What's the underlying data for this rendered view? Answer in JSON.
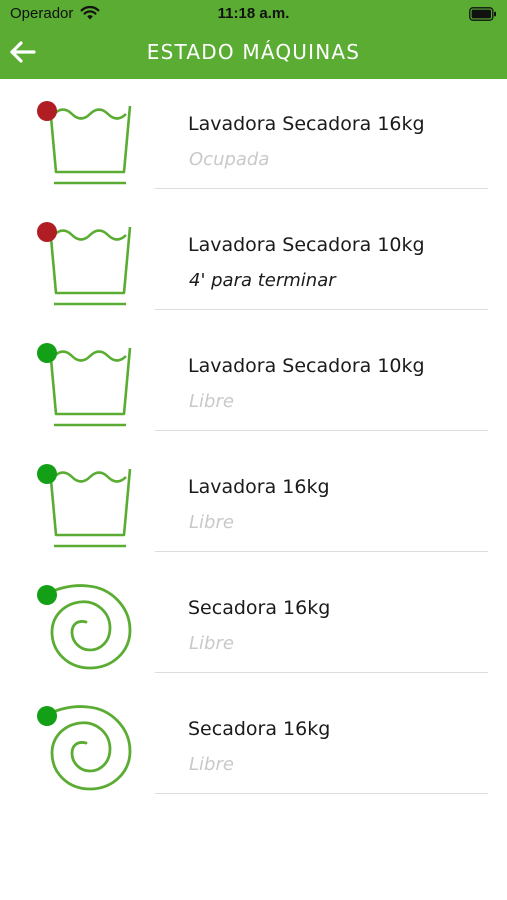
{
  "status_bar": {
    "carrier": "Operador",
    "time": "11:18 a.m."
  },
  "header": {
    "title": "ESTADO MÁQUINAS",
    "back_icon": "arrow-left-icon"
  },
  "colors": {
    "brand_green": "#5aac33",
    "busy_red": "#b01e24",
    "free_green": "#14a016"
  },
  "machines": [
    {
      "name": "Lavadora Secadora 16kg",
      "status": "Ocupada",
      "type": "washer",
      "state": "busy",
      "icon": "washer-icon"
    },
    {
      "name": "Lavadora Secadora 10kg",
      "status": "4' para terminar",
      "type": "washer",
      "state": "busy",
      "icon": "washer-icon"
    },
    {
      "name": "Lavadora Secadora 10kg",
      "status": "Libre",
      "type": "washer",
      "state": "free",
      "icon": "washer-icon"
    },
    {
      "name": "Lavadora 16kg",
      "status": "Libre",
      "type": "washer",
      "state": "free",
      "icon": "washer-icon"
    },
    {
      "name": "Secadora 16kg",
      "status": "Libre",
      "type": "dryer",
      "state": "free",
      "icon": "dryer-icon"
    },
    {
      "name": "Secadora 16kg",
      "status": "Libre",
      "type": "dryer",
      "state": "free",
      "icon": "dryer-icon"
    }
  ]
}
